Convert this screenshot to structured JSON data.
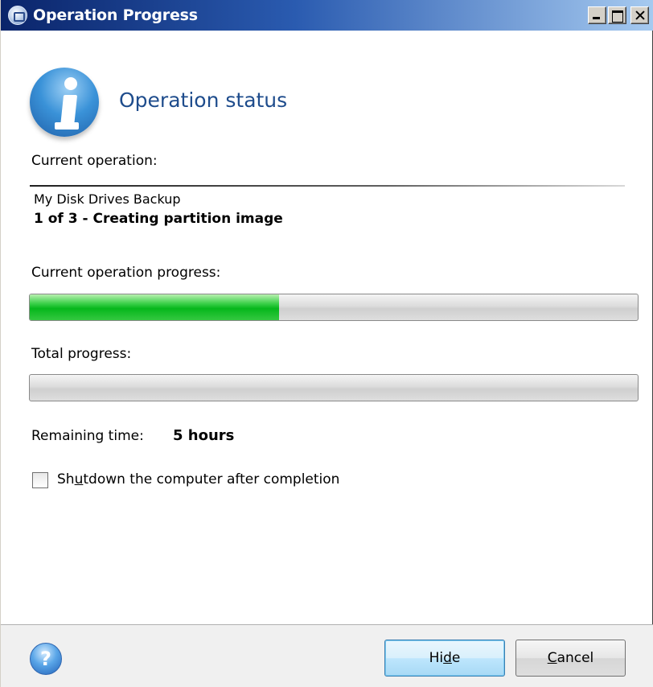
{
  "window": {
    "title": "Operation Progress",
    "minimize_label": "Minimize",
    "maximize_label": "Maximize",
    "close_label": "Close"
  },
  "header": {
    "title": "Operation status",
    "icon": "information-icon"
  },
  "current_operation": {
    "label": "Current operation:",
    "name": "My Disk Drives Backup",
    "step": "1 of 3 - Creating partition image"
  },
  "current_progress": {
    "label": "Current operation progress:",
    "value_percent": 41
  },
  "total_progress": {
    "label": "Total progress:",
    "value_percent": 0
  },
  "remaining": {
    "label": "Remaining time:",
    "value": "5 hours"
  },
  "shutdown": {
    "label_pre": "Sh",
    "label_underline": "u",
    "label_post": "tdown the computer after completion",
    "checked": false
  },
  "footer": {
    "help_icon": "help-icon",
    "help_glyph": "?",
    "hide_pre": "Hi",
    "hide_underline": "d",
    "hide_post": "e",
    "cancel_underline": "C",
    "cancel_post": "ancel"
  },
  "colors": {
    "accent": "#1e4c8c",
    "progress_fill": "#06b71c",
    "titlebar_start": "#0a246a",
    "titlebar_end": "#a6caf0"
  }
}
